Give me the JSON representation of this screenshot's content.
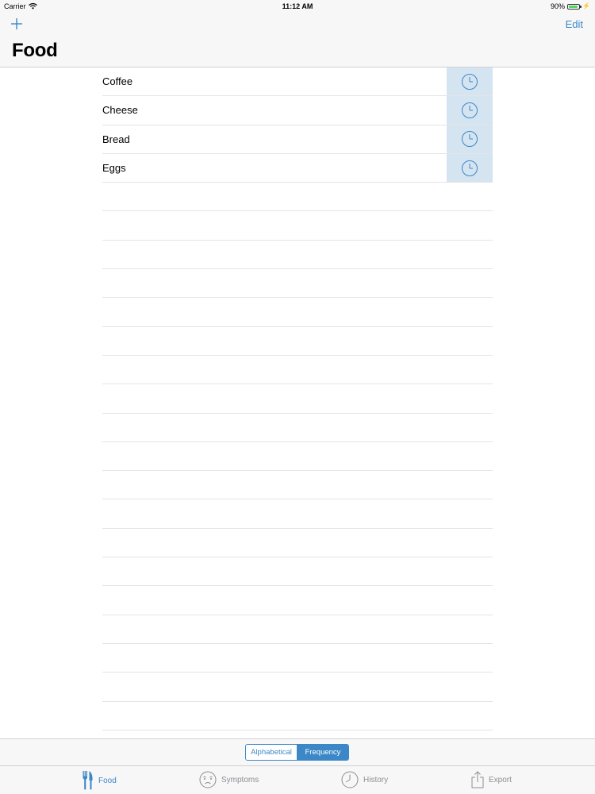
{
  "status": {
    "carrier": "Carrier",
    "time": "11:12 AM",
    "battery": "90%",
    "battery_level": 0.9,
    "icons": [
      "wifi-icon",
      "battery-icon",
      "charging-icon"
    ]
  },
  "nav": {
    "title": "Food",
    "edit_label": "Edit",
    "add_icon": "plus-icon"
  },
  "list": {
    "items": [
      {
        "label": "Coffee"
      },
      {
        "label": "Cheese"
      },
      {
        "label": "Bread"
      },
      {
        "label": "Eggs"
      }
    ],
    "row_action_icon": "clock-icon",
    "empty_rows": 19
  },
  "sort": {
    "options": [
      "Alphabetical",
      "Frequency"
    ],
    "selected": "Frequency"
  },
  "tabs": [
    {
      "label": "Food",
      "icon": "fork-knife-icon",
      "active": true
    },
    {
      "label": "Symptoms",
      "icon": "face-icon",
      "active": false
    },
    {
      "label": "History",
      "icon": "clock-icon",
      "active": false
    },
    {
      "label": "Export",
      "icon": "share-icon",
      "active": false
    }
  ],
  "colors": {
    "accent": "#3c87c7",
    "row_action_bg": "#d5e4f1",
    "bar_bg": "#f7f7f8",
    "inactive_tab": "#8e8e93"
  }
}
